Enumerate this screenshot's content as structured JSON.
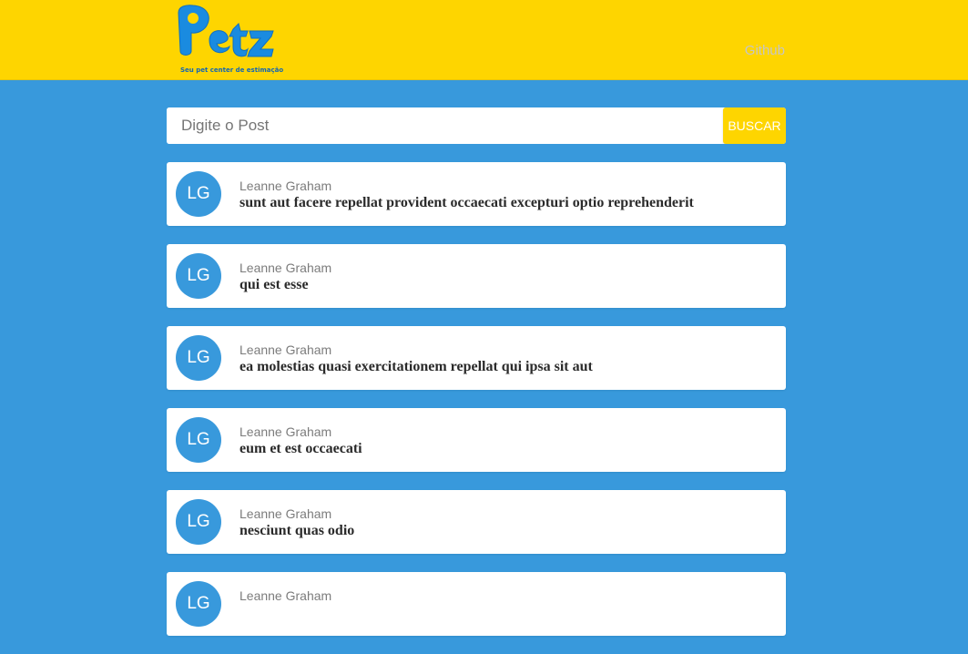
{
  "header": {
    "logo_text": "Petz",
    "logo_tagline": "Seu pet center de estimação",
    "nav_link": "Github"
  },
  "search": {
    "placeholder": "Digite o Post",
    "button_label": "BUSCAR"
  },
  "posts": [
    {
      "initials": "LG",
      "author": "Leanne Graham",
      "title": "sunt aut facere repellat provident occaecati excepturi optio reprehenderit"
    },
    {
      "initials": "LG",
      "author": "Leanne Graham",
      "title": "qui est esse"
    },
    {
      "initials": "LG",
      "author": "Leanne Graham",
      "title": "ea molestias quasi exercitationem repellat qui ipsa sit aut"
    },
    {
      "initials": "LG",
      "author": "Leanne Graham",
      "title": "eum et est occaecati"
    },
    {
      "initials": "LG",
      "author": "Leanne Graham",
      "title": "nesciunt quas odio"
    },
    {
      "initials": "LG",
      "author": "Leanne Graham",
      "title": ""
    }
  ],
  "colors": {
    "header_bg": "#fed500",
    "page_bg": "#3899dc",
    "logo_blue": "#1a8be0",
    "avatar_bg": "#3899dc"
  }
}
